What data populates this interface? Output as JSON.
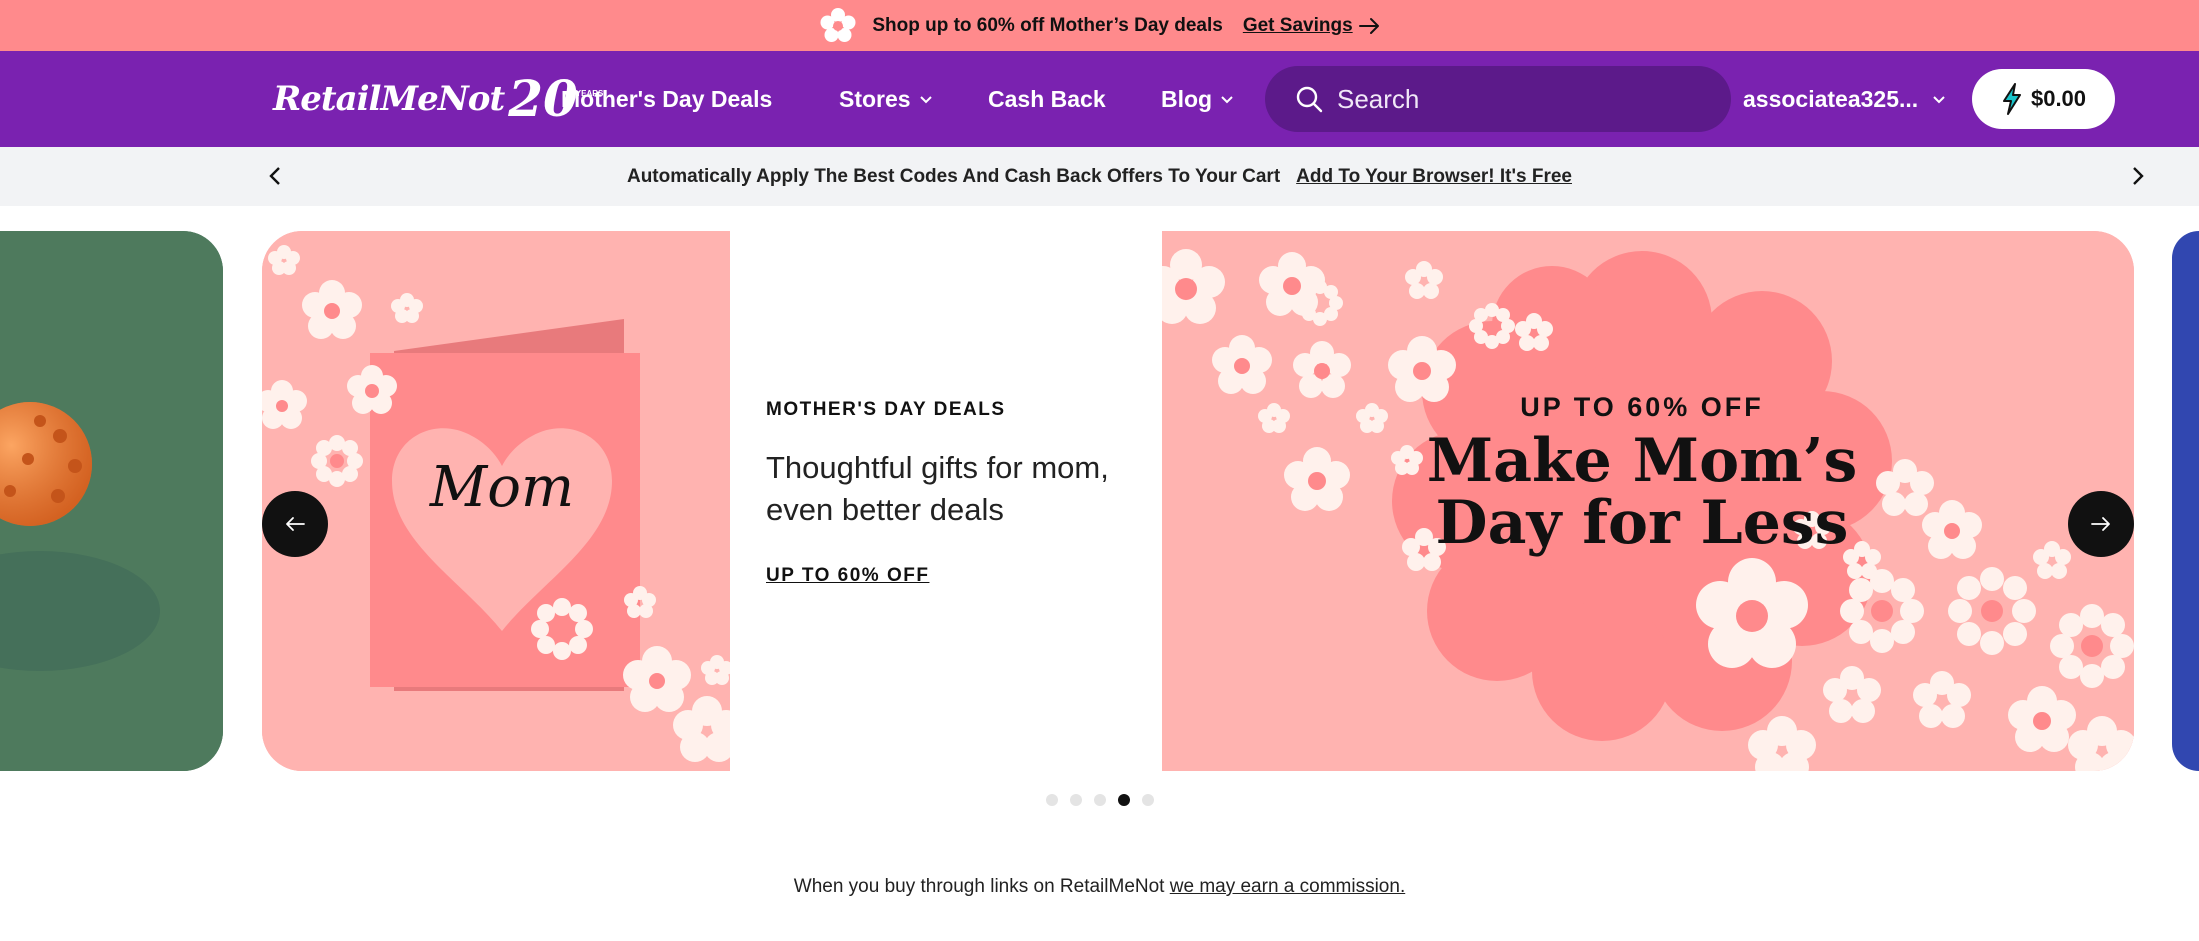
{
  "promo": {
    "text": "Shop up to 60% off Mother’s Day deals",
    "link": "Get Savings"
  },
  "header": {
    "logo_word": "RetailMeNot",
    "logo_anniversary": "20",
    "logo_years": "YEARS",
    "nav": [
      {
        "label": "Mother's Day Deals"
      },
      {
        "label": "Stores"
      },
      {
        "label": "Cash Back"
      },
      {
        "label": "Blog"
      }
    ],
    "search_placeholder": "Search",
    "username": "associatea325...",
    "wallet_balance": "$0.00"
  },
  "extension_strip": {
    "message": "Automatically Apply The Best Codes And Cash Back Offers To Your Cart",
    "cta": "Add To Your Browser! It's Free"
  },
  "carousel": {
    "eyebrow": "MOTHER'S DAY DEALS",
    "headline": "Thoughtful gifts for mom, even better deals",
    "offer_link": "UP TO 60% OFF",
    "card_text": "Mom",
    "banner_kicker": "UP TO 60% OFF",
    "banner_line1": "Make Mom’s",
    "banner_line2": "Day for Less",
    "slide_count": 5,
    "active_slide": 4
  },
  "disclaimer": {
    "text": "When you buy through links on RetailMeNot",
    "link": "we may earn a commission."
  },
  "colors": {
    "promo_bg": "#ff8a8c",
    "header_bg": "#7a22b0",
    "search_bg": "#5c1a8a",
    "slide_pink": "#ffb3b0",
    "flower_center": "#ff8a8c",
    "slide_left_green": "#4e7a5d",
    "slide_right_blue": "#3147b0"
  },
  "icons": [
    "flower-icon",
    "arrow-right-icon",
    "chevron-down-icon",
    "search-icon",
    "lightning-bolt-icon",
    "chevron-left-icon",
    "chevron-right-icon"
  ]
}
